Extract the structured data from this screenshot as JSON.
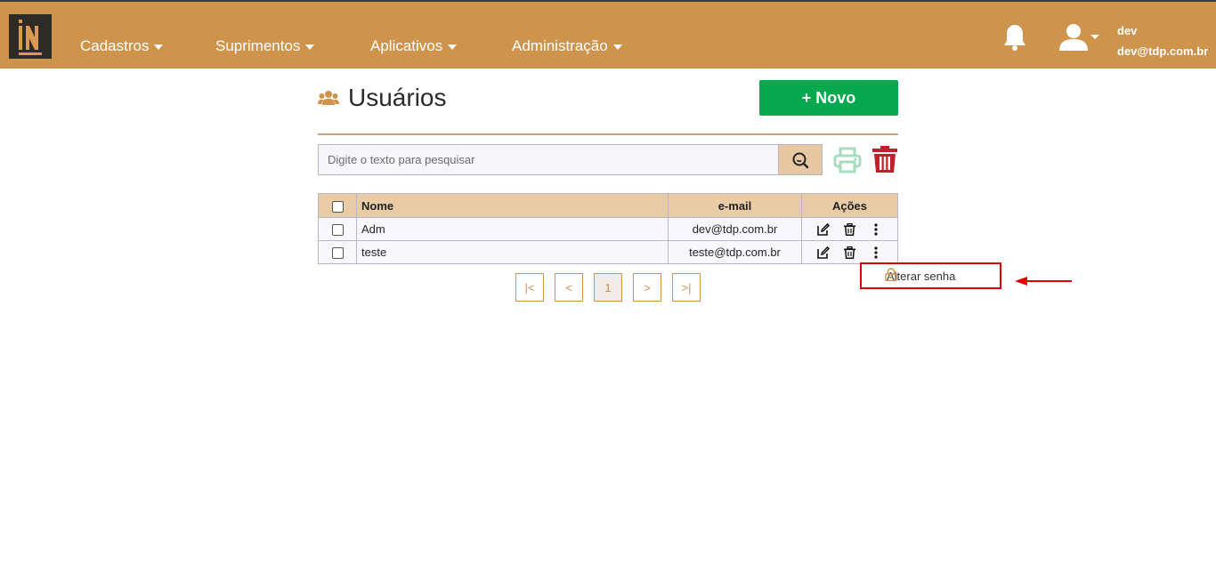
{
  "nav": {
    "items": [
      {
        "label": "Cadastros"
      },
      {
        "label": "Suprimentos"
      },
      {
        "label": "Aplicativos"
      },
      {
        "label": "Administração"
      }
    ],
    "user": {
      "name": "dev",
      "email": "dev@tdp.com.br"
    }
  },
  "page": {
    "title": "Usuários",
    "new_button": "+ Novo",
    "search_placeholder": "Digite o texto para pesquisar"
  },
  "table": {
    "headers": {
      "name": "Nome",
      "email": "e-mail",
      "actions": "Ações"
    },
    "rows": [
      {
        "name": "Adm",
        "email": "dev@tdp.com.br"
      },
      {
        "name": "teste",
        "email": "teste@tdp.com.br"
      }
    ]
  },
  "dropdown": {
    "item": "Alterar senha"
  },
  "pagination": {
    "current": "1",
    "first": "|<",
    "prev": "<",
    "next": ">",
    "last": ">|"
  },
  "colors": {
    "navbar": "#cf944c",
    "accent": "#05a84d",
    "danger": "#c0202a",
    "highlight": "#e00000"
  },
  "icons": [
    "logo-icon",
    "bell-icon",
    "user-icon",
    "users-icon",
    "search-icon",
    "print-icon",
    "trash-icon",
    "edit-icon",
    "kebab-icon",
    "lock-icon",
    "arrow-icon"
  ]
}
